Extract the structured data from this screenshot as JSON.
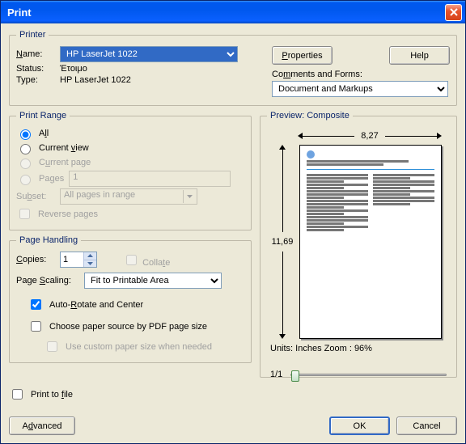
{
  "window": {
    "title": "Print"
  },
  "printer": {
    "legend": "Printer",
    "nameLabel": "Name:",
    "nameValue": "HP LaserJet 1022",
    "statusLabel": "Status:",
    "statusValue": "Έτοιμο",
    "typeLabel": "Type:",
    "typeValue": "HP LaserJet 1022",
    "propertiesBtn": "Properties",
    "helpBtn": "Help",
    "commentsLabel": "Comments and Forms:",
    "commentsValue": "Document and Markups"
  },
  "range": {
    "legend": "Print Range",
    "all": "All",
    "currentView": "Current view",
    "currentPage": "Current page",
    "pages": "Pages",
    "pagesValue": "1",
    "subsetLabel": "Subset:",
    "subsetValue": "All pages in range",
    "reverse": "Reverse pages"
  },
  "handling": {
    "legend": "Page Handling",
    "copiesLabel": "Copies:",
    "copiesValue": "1",
    "collate": "Collate",
    "scalingLabel": "Page Scaling:",
    "scalingValue": "Fit to Printable Area",
    "autoRotate": "Auto-Rotate and Center",
    "choosePaper": "Choose paper source by PDF page size",
    "customPaper": "Use custom paper size when needed"
  },
  "printToFile": "Print to file",
  "preview": {
    "legend": "Preview: Composite",
    "width": "8,27",
    "height": "11,69",
    "units": "Units: Inches",
    "zoom": "Zoom :  96%",
    "page": "1/1"
  },
  "buttons": {
    "advanced": "Advanced",
    "ok": "OK",
    "cancel": "Cancel"
  }
}
